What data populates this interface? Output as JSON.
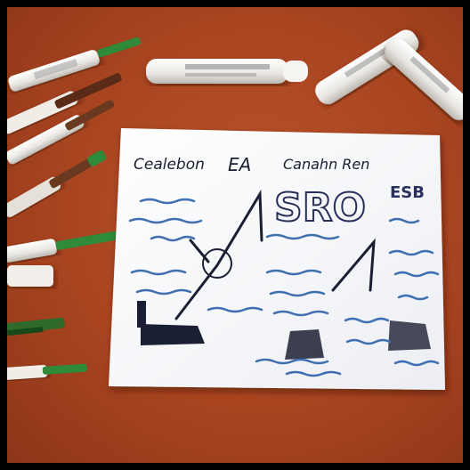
{
  "scene": {
    "description_tags": [
      "desk-surface",
      "paper-sheet",
      "markers",
      "sketches"
    ]
  },
  "paper": {
    "heading_left": "Cealebon",
    "heading_mid": "EA",
    "heading_right": "Canahn Ren",
    "big_text": "SRO",
    "code_right": "ESB",
    "colors": {
      "ink": "#1b1f33",
      "blue_ink": "#3f6fb0",
      "paper": "#f7f8fb",
      "desk": "#a84420",
      "marker_green": "#2f8a3a"
    }
  }
}
